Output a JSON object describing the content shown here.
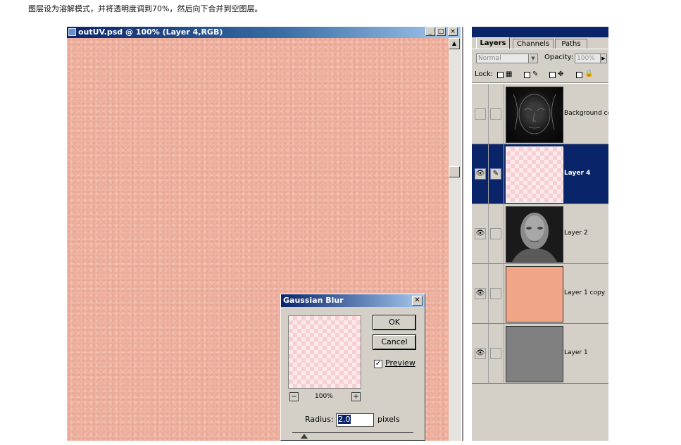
{
  "caption": "图层设为溶解模式，并将透明度调到70%，然后向下合并到空图层。",
  "document": {
    "title": "outUV.psd @ 100% (Layer 4,RGB)",
    "window_buttons": [
      "_",
      "□",
      "×"
    ]
  },
  "layers_panel": {
    "tabs": [
      "Layers",
      "Channels",
      "Paths"
    ],
    "active_tab": "Layers",
    "blend_mode": "Normal",
    "opacity_label": "Opacity:",
    "opacity_value": "100%",
    "lock_label": "Lock:",
    "layers": [
      {
        "name": "Background co",
        "visible": false,
        "thumb": "dark-face-edges"
      },
      {
        "name": "Layer 4",
        "visible": true,
        "selected": true,
        "brush": true,
        "thumb": "transparent-pink"
      },
      {
        "name": "Layer 2",
        "visible": true,
        "thumb": "gray-face"
      },
      {
        "name": "Layer 1 copy",
        "visible": true,
        "thumb": "salmon-fill",
        "color": "#f0a586"
      },
      {
        "name": "Layer 1",
        "visible": true,
        "thumb": "gray-fill",
        "color": "#808080"
      }
    ]
  },
  "gaussian_blur": {
    "title": "Gaussian Blur",
    "ok_label": "OK",
    "cancel_label": "Cancel",
    "preview_label": "Preview",
    "preview_checked": true,
    "zoom": "100%",
    "zoom_out": "−",
    "zoom_in": "+",
    "radius_label": "Radius:",
    "radius_value": "2.0",
    "radius_units": "pixels"
  },
  "colors": {
    "skin": "#eeb4a4",
    "titlebar": "#0a246a",
    "selected_layer": "#0a246a",
    "panel": "#d4d0c8"
  }
}
